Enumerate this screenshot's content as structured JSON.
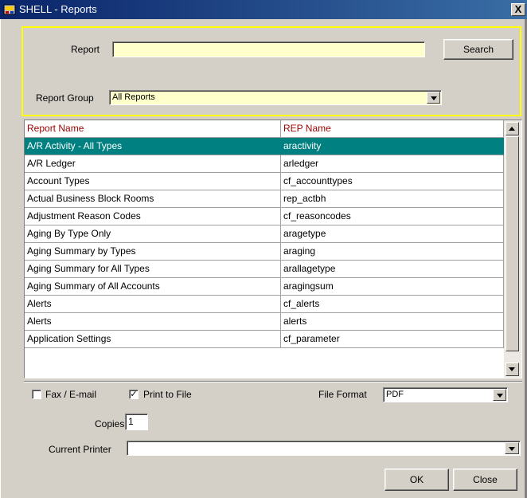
{
  "window": {
    "title": "SHELL - Reports",
    "close_glyph": "X"
  },
  "search": {
    "report_label": "Report",
    "report_value": "",
    "search_button": "Search",
    "group_label": "Report Group",
    "group_value": "All Reports"
  },
  "grid": {
    "columns": [
      "Report Name",
      "REP Name"
    ],
    "selected_index": 0,
    "rows": [
      [
        "A/R Activity - All Types",
        "aractivity"
      ],
      [
        "A/R Ledger",
        "arledger"
      ],
      [
        "Account Types",
        "cf_accounttypes"
      ],
      [
        "Actual Business Block Rooms",
        "rep_actbh"
      ],
      [
        "Adjustment Reason Codes",
        "cf_reasoncodes"
      ],
      [
        "Aging By Type Only",
        "aragetype"
      ],
      [
        "Aging Summary by Types",
        "araging"
      ],
      [
        "Aging Summary for All Types",
        "arallagetype"
      ],
      [
        "Aging Summary of All Accounts",
        "aragingsum"
      ],
      [
        "Alerts",
        "cf_alerts"
      ],
      [
        "Alerts",
        "alerts"
      ],
      [
        "Application Settings",
        "cf_parameter"
      ]
    ]
  },
  "options": {
    "fax_label": "Fax / E-mail",
    "fax_checked": false,
    "print_file_label": "Print to File",
    "print_file_checked": true,
    "file_format_label": "File Format",
    "file_format_value": "PDF",
    "copies_label": "Copies",
    "copies_value": "1",
    "printer_label": "Current Printer",
    "printer_value": ""
  },
  "buttons": {
    "ok": "OK",
    "close": "Close"
  },
  "colors": {
    "selected_row": "#008080",
    "header_text": "#990000",
    "input_bg": "#ffffcc",
    "focus_border": "#ffff00"
  }
}
